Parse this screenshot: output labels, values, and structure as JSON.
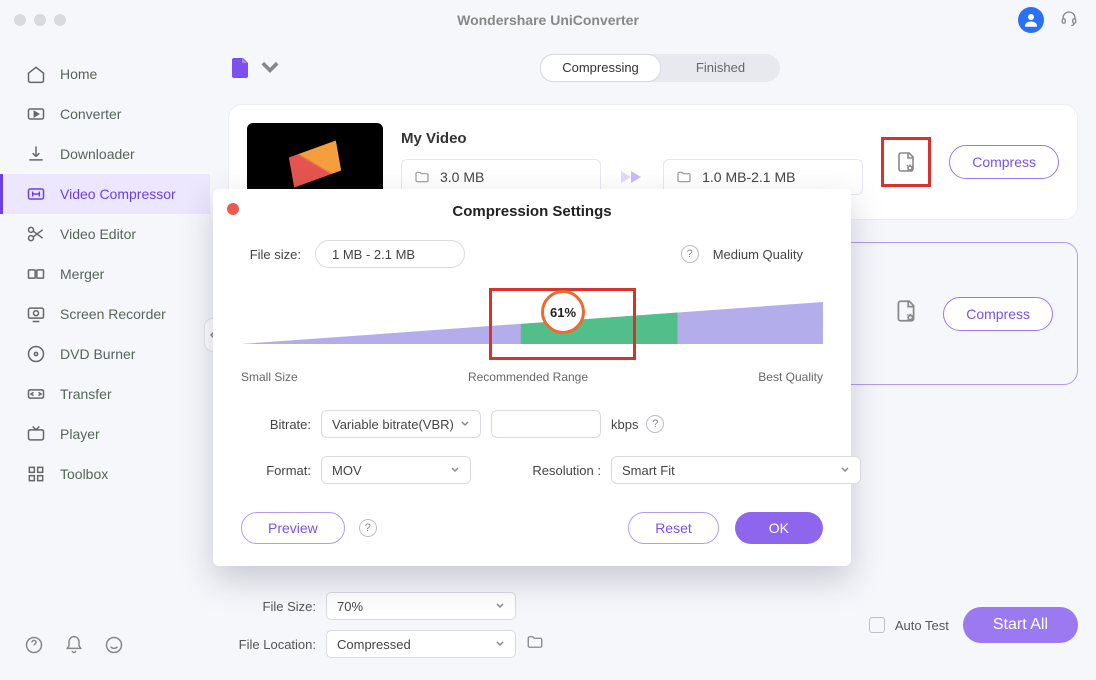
{
  "app_title": "Wondershare UniConverter",
  "sidebar": {
    "items": [
      {
        "label": "Home"
      },
      {
        "label": "Converter"
      },
      {
        "label": "Downloader"
      },
      {
        "label": "Video Compressor"
      },
      {
        "label": "Video Editor"
      },
      {
        "label": "Merger"
      },
      {
        "label": "Screen Recorder"
      },
      {
        "label": "DVD Burner"
      },
      {
        "label": "Transfer"
      },
      {
        "label": "Player"
      },
      {
        "label": "Toolbox"
      }
    ]
  },
  "tabs": {
    "compressing": "Compressing",
    "finished": "Finished"
  },
  "card": {
    "title": "My Video",
    "src_size": "3.0 MB",
    "out_size": "1.0 MB-2.1 MB",
    "compress": "Compress"
  },
  "second_card": {
    "compress": "Compress"
  },
  "bottom": {
    "file_size_label": "File Size:",
    "file_size_value": "70%",
    "file_location_label": "File Location:",
    "file_location_value": "Compressed",
    "auto_test": "Auto Test",
    "start_all": "Start  All"
  },
  "modal": {
    "title": "Compression Settings",
    "file_size_label": "File size:",
    "file_size_value": "1 MB - 2.1 MB",
    "quality": "Medium Quality",
    "percent": "61%",
    "slider": {
      "small": "Small Size",
      "rec": "Recommended Range",
      "best": "Best Quality"
    },
    "bitrate_label": "Bitrate:",
    "bitrate_mode": "Variable bitrate(VBR)",
    "kbps": "kbps",
    "format_label": "Format:",
    "format_value": "MOV",
    "resolution_label": "Resolution :",
    "resolution_value": "Smart Fit",
    "preview": "Preview",
    "reset": "Reset",
    "ok": "OK"
  }
}
